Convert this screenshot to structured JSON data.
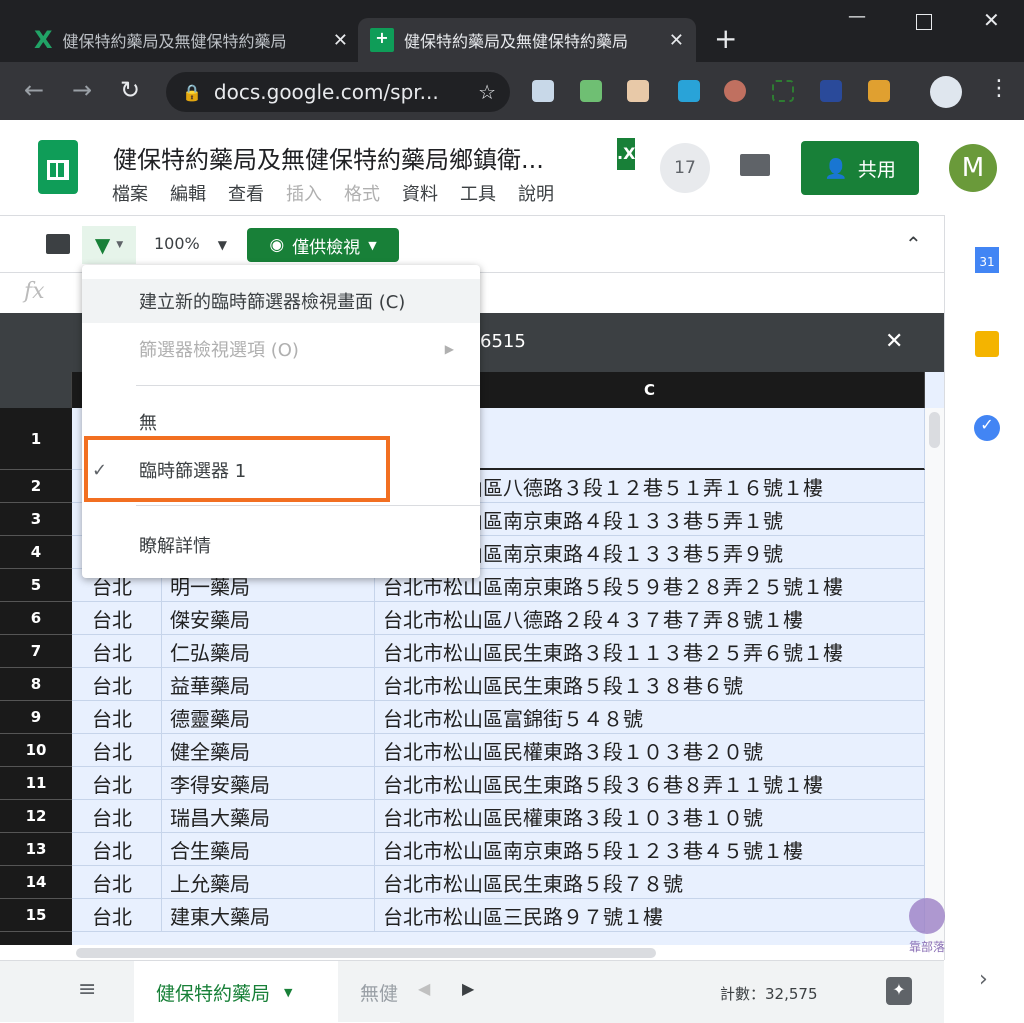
{
  "browser": {
    "tabs": [
      {
        "title": "健保特約藥局及無健保特約藥局",
        "icon": "excel-icon"
      },
      {
        "title": "健保特約藥局及無健保特約藥局",
        "icon": "sheets-icon"
      }
    ],
    "url": "docs.google.com/spr...",
    "new_tab": "+"
  },
  "doc": {
    "title": "健保特約藥局及無健保特約藥局鄉鎮衛...",
    "badge": ".X",
    "menu": [
      "檔案",
      "編輯",
      "查看",
      "插入",
      "格式",
      "資料",
      "工具",
      "說明"
    ],
    "menu_disabled": [
      false,
      false,
      false,
      true,
      true,
      false,
      false,
      false
    ],
    "comment_count": "17",
    "share_label": "共用",
    "avatar": "M",
    "accent": "#188038"
  },
  "toolbar": {
    "zoom": "100%",
    "view_mode": "僅供檢視"
  },
  "formula": {
    "fx": "fx"
  },
  "filter_bar": {
    "name_suffix": "6515",
    "close": "✕"
  },
  "dropdown": {
    "items": [
      {
        "label": "建立新的臨時篩選器檢視畫面 (C)"
      },
      {
        "label": "篩選器檢視選項 (O)",
        "disabled": true
      },
      {
        "label": "無"
      },
      {
        "label": "臨時篩選器 1",
        "checked": true
      },
      {
        "label": "瞭解詳情"
      }
    ],
    "highlight_color": "#f26f21"
  },
  "grid": {
    "column_header": "C",
    "rows": [
      {
        "n": "1",
        "a": "",
        "b": "",
        "c": ""
      },
      {
        "n": "2",
        "a": "台北",
        "b": "",
        "c": "台北市松山區八德路３段１２巷５１弄１６號１樓"
      },
      {
        "n": "3",
        "a": "台北",
        "b": "",
        "c": "台北市松山區南京東路４段１３３巷５弄１號"
      },
      {
        "n": "4",
        "a": "台北",
        "b": "",
        "c": "台北市松山區南京東路４段１３３巷５弄９號"
      },
      {
        "n": "5",
        "a": "台北",
        "b": "明一藥局",
        "c": "台北市松山區南京東路５段５９巷２８弄２５號１樓"
      },
      {
        "n": "6",
        "a": "台北",
        "b": "傑安藥局",
        "c": "台北市松山區八德路２段４３７巷７弄８號１樓"
      },
      {
        "n": "7",
        "a": "台北",
        "b": "仁弘藥局",
        "c": "台北市松山區民生東路３段１１３巷２５弄６號１樓"
      },
      {
        "n": "8",
        "a": "台北",
        "b": "益華藥局",
        "c": "台北市松山區民生東路５段１３８巷６號"
      },
      {
        "n": "9",
        "a": "台北",
        "b": "德靈藥局",
        "c": "台北市松山區富錦街５４８號"
      },
      {
        "n": "10",
        "a": "台北",
        "b": "健全藥局",
        "c": "台北市松山區民權東路３段１０３巷２０號"
      },
      {
        "n": "11",
        "a": "台北",
        "b": "李得安藥局",
        "c": "台北市松山區民生東路５段３６巷８弄１１號１樓"
      },
      {
        "n": "12",
        "a": "台北",
        "b": "瑞昌大藥局",
        "c": "台北市松山區民權東路３段１０３巷１０號"
      },
      {
        "n": "13",
        "a": "台北",
        "b": "合生藥局",
        "c": "台北市松山區南京東路５段１２３巷４５號１樓"
      },
      {
        "n": "14",
        "a": "台北",
        "b": "上允藥局",
        "c": "台北市松山區民生東路５段７８號"
      },
      {
        "n": "15",
        "a": "台北",
        "b": "建東大藥局",
        "c": "台北市松山區三民路９７號１樓"
      }
    ]
  },
  "sheets": {
    "active": "健保特約藥局",
    "other": "無健",
    "count": "計數：32,575"
  },
  "watermark": "靠部落"
}
